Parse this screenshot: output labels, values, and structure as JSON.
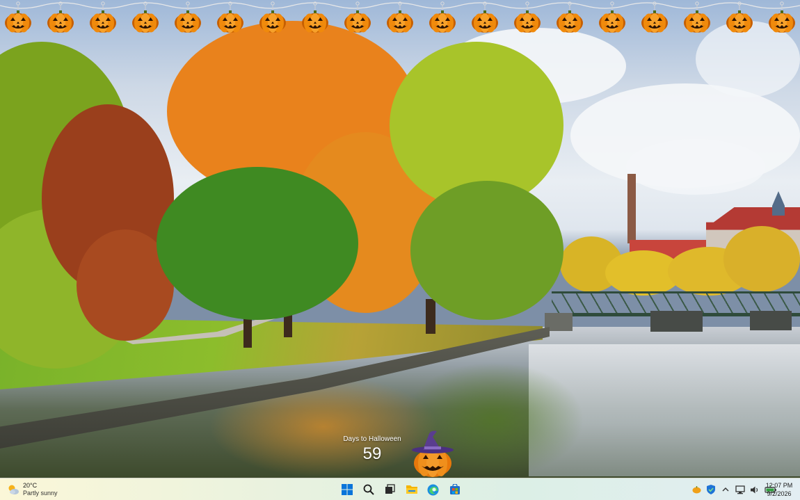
{
  "desktop": {
    "wallpaper": "autumn-canal-park-scene",
    "garland": {
      "item_icon": "jack-o-lantern-icon",
      "count": 19
    }
  },
  "widget": {
    "label": "Days to Halloween",
    "value": "59",
    "icon": "witch-hat-pumpkin-icon"
  },
  "taskbar": {
    "weather": {
      "temp": "20°C",
      "desc": "Partly sunny",
      "icon": "partly-sunny-icon"
    },
    "apps": [
      {
        "name": "start",
        "icon": "windows-logo-icon"
      },
      {
        "name": "search",
        "icon": "search-icon"
      },
      {
        "name": "task-view",
        "icon": "task-view-icon"
      },
      {
        "name": "file-explorer",
        "icon": "folder-icon"
      },
      {
        "name": "edge",
        "icon": "edge-browser-icon"
      },
      {
        "name": "store",
        "icon": "store-icon"
      }
    ],
    "tray": [
      {
        "name": "pumpkin-tray",
        "icon": "pumpkin-tray-icon"
      },
      {
        "name": "security",
        "icon": "shield-icon"
      },
      {
        "name": "chevron",
        "icon": "chevron-up-icon"
      },
      {
        "name": "network",
        "icon": "network-icon"
      },
      {
        "name": "volume",
        "icon": "speaker-icon"
      },
      {
        "name": "battery",
        "icon": "battery-icon"
      }
    ],
    "clock": {
      "time": "12:07 PM",
      "date": "9/2/2026"
    }
  },
  "colors": {
    "pumpkin": "#f08a0c",
    "pumpkin_dark": "#c65f00",
    "face": "#2b1200",
    "hat": "#5a3d8f",
    "windows_blue": "#0a74da"
  }
}
